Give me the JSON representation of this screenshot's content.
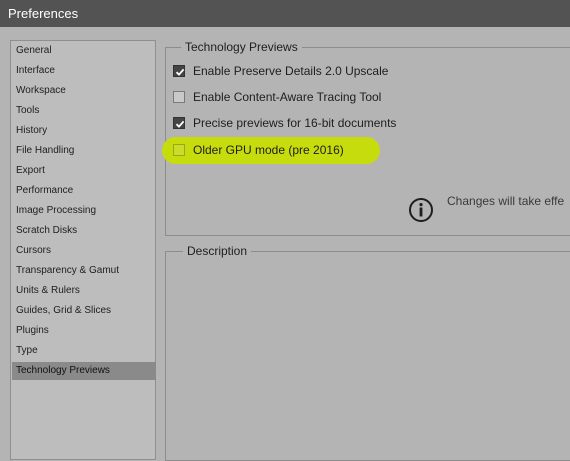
{
  "window": {
    "title": "Preferences"
  },
  "sidebar": {
    "items": [
      {
        "label": "General"
      },
      {
        "label": "Interface"
      },
      {
        "label": "Workspace"
      },
      {
        "label": "Tools"
      },
      {
        "label": "History"
      },
      {
        "label": "File Handling"
      },
      {
        "label": "Export"
      },
      {
        "label": "Performance"
      },
      {
        "label": "Image Processing"
      },
      {
        "label": "Scratch Disks"
      },
      {
        "label": "Cursors"
      },
      {
        "label": "Transparency & Gamut"
      },
      {
        "label": "Units & Rulers"
      },
      {
        "label": "Guides, Grid & Slices"
      },
      {
        "label": "Plugins"
      },
      {
        "label": "Type"
      },
      {
        "label": "Technology Previews",
        "selected": true
      }
    ]
  },
  "tech_previews": {
    "title": "Technology Previews",
    "options": [
      {
        "label": "Enable Preserve Details 2.0 Upscale",
        "checked": true
      },
      {
        "label": "Enable Content-Aware Tracing Tool",
        "checked": false
      },
      {
        "label": "Precise previews for 16-bit documents",
        "checked": true
      },
      {
        "label": "Older GPU mode (pre 2016)",
        "checked": false,
        "highlighted": true
      }
    ],
    "notice": "Changes will take effe",
    "notice_icon": "info-icon",
    "highlight_color": "#c7dc0c"
  },
  "description": {
    "title": "Description"
  }
}
